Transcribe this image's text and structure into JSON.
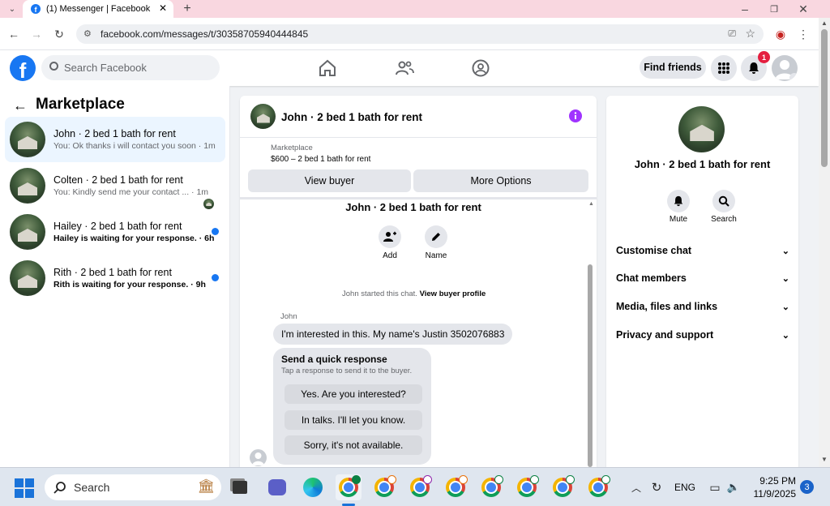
{
  "browser": {
    "tab_title": "(1) Messenger | Facebook",
    "url": "facebook.com/messages/t/30358705940444845"
  },
  "fb_header": {
    "search_placeholder": "Search Facebook",
    "find_friends": "Find friends",
    "notification_count": "1"
  },
  "sidebar": {
    "title": "Marketplace",
    "conversations": [
      {
        "name": "John · 2 bed 1 bath for rent",
        "preview": "You: Ok thanks i will contact you soon · 1m",
        "unread": false
      },
      {
        "name": "Colten · 2 bed 1 bath for rent",
        "preview": "You: Kindly send me your contact ... · 1m",
        "unread": false
      },
      {
        "name": "Hailey · 2 bed 1 bath for rent",
        "preview": "Hailey is waiting for your response. · 6h",
        "unread": true
      },
      {
        "name": "Rith · 2 bed 1 bath for rent",
        "preview": "Rith is waiting for your response. · 9h",
        "unread": true
      }
    ]
  },
  "chat": {
    "header_title": "John · 2 bed 1 bath for rent",
    "listing_label": "Marketplace",
    "listing_detail": "$600 – 2 bed 1 bath for rent",
    "view_buyer": "View buyer",
    "more_options": "More Options",
    "thread_title": "John · 2 bed 1 bath for rent",
    "add_label": "Add",
    "name_label": "Name",
    "started_text": "John started this chat.",
    "view_profile": "View buyer profile",
    "sender": "John",
    "message": "I'm interested in this. My name's Justin 3502076883",
    "quick_title": "Send a quick response",
    "quick_sub": "Tap a response to send it to the buyer.",
    "quick_options": [
      "Yes. Are you interested?",
      "In talks. I'll let you know.",
      "Sorry, it's not available."
    ]
  },
  "info": {
    "title": "John · 2 bed 1 bath for rent",
    "mute": "Mute",
    "search": "Search",
    "items": [
      "Customise chat",
      "Chat members",
      "Media, files and links",
      "Privacy and support"
    ]
  },
  "taskbar": {
    "search_placeholder": "Search",
    "lang": "ENG",
    "time": "9:25 PM",
    "date": "11/9/2025",
    "notif": "3"
  }
}
